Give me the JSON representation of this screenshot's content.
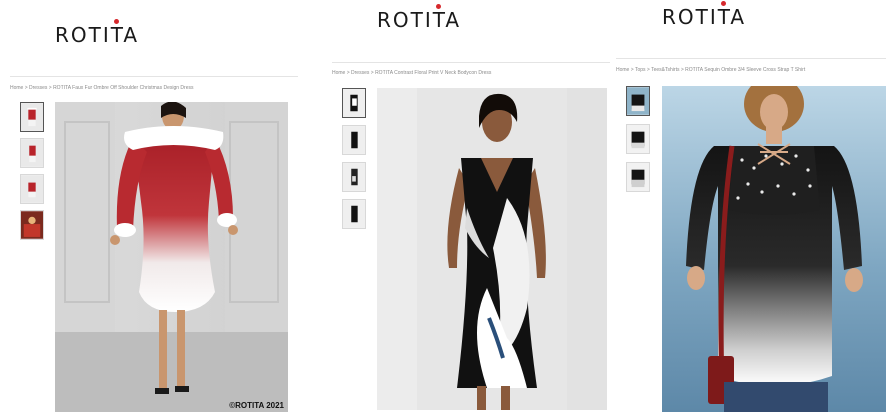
{
  "panels": [
    {
      "brand": "ROTITA",
      "breadcrumb": "Home  >  Dresses  >  ROTITA Faux Fur Ombre Off Shoulder Christmas Design Dress",
      "copyright": "©ROTITA 2021",
      "thumbnail_count": 4
    },
    {
      "brand": "ROTITA",
      "breadcrumb": "Home  >  Dresses  >  ROTITA Contrast Floral Print V Neck Bodycon Dress",
      "thumbnail_count": 4
    },
    {
      "brand": "ROTITA",
      "breadcrumb": "Home  >  Tops  >  Tees&Tshirts  >  ROTITA Sequin Ombre 3/4 Sleeve Cross Strap T Shirt",
      "thumbnail_count": 3
    }
  ],
  "colors": {
    "brand_text": "#1a1a1a",
    "logo_accent": "#d6282c",
    "dress1_red": "#b8232a",
    "dress2_black": "#111111",
    "top3_black": "#141414"
  }
}
